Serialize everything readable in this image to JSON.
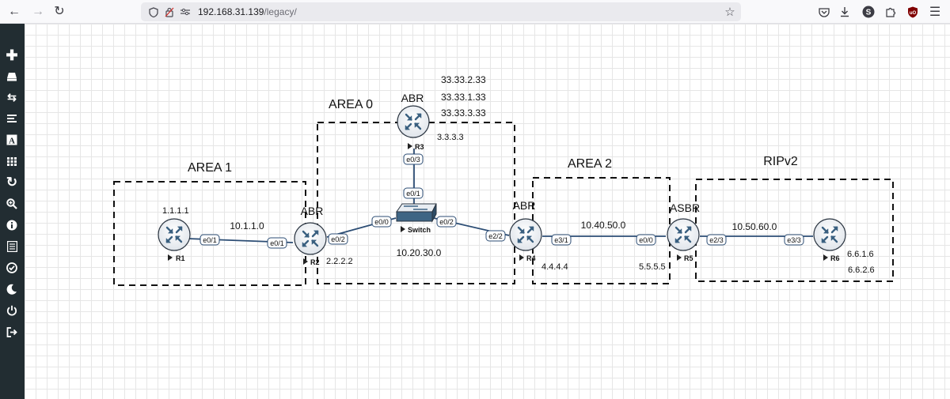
{
  "browser": {
    "url_host": "192.168.31.139",
    "url_path": "/legacy/",
    "icons": [
      "back-arrow-icon",
      "forward-arrow-icon",
      "reload-icon",
      "shield-icon",
      "tracking-icon",
      "permissions-icon",
      "bookmark-star-icon",
      "pocket-icon",
      "download-icon",
      "profile-icon",
      "extensions-icon",
      "ublock-icon",
      "menu-icon"
    ],
    "profile_letter": "S"
  },
  "sidebar": {
    "items": [
      "add-icon",
      "nodes-icon",
      "networks-icon",
      "startup-config-icon",
      "text-icon",
      "picture-icon",
      "refresh-icon",
      "zoom-icon",
      "status-icon",
      "lab-details-icon",
      "lock-icon",
      "dark-mode-icon",
      "power-icon",
      "logout-icon"
    ]
  },
  "topology": {
    "areas": {
      "area1": "AREA 1",
      "area0": "AREA 0",
      "area2": "AREA 2",
      "ripv2": "RIPv2"
    },
    "roles": {
      "r2": "ABR",
      "r3": "ABR",
      "r4": "ABR",
      "r5": "ASBR"
    },
    "nodes": {
      "r1": "R1",
      "r2": "R2",
      "r3": "R3",
      "r4": "R4",
      "r5": "R5",
      "r6": "R6",
      "switch": "Switch"
    },
    "networks": {
      "n1": "10.1.1.0",
      "n2": "10.20.30.0",
      "n3": "10.40.50.0",
      "n4": "10.50.60.0"
    },
    "router_ids": {
      "r1": "1.1.1.1",
      "r2": "2.2.2.2",
      "r3": "3.3.3.3",
      "r3_loop1": "33.33.2.33",
      "r3_loop2": "33.33.1.33",
      "r3_loop3": "33.33.3.33",
      "r4": "4.4.4.4",
      "r5": "5.5.5.5",
      "r6a": "6.6.1.6",
      "r6b": "6.6.2.6"
    },
    "interfaces": {
      "r1_e01": "e0/1",
      "r2_e01": "e0/1",
      "r2_e02": "e0/2",
      "sw_e00": "e0/0",
      "sw_e01": "e0/1",
      "sw_e02": "e0/2",
      "r3_e03": "e0/3",
      "r4_e22": "e2/2",
      "r4_e31": "e3/1",
      "r5_e00": "e0/0",
      "r5_e23": "e2/3",
      "r6_e33": "e3/3"
    }
  }
}
